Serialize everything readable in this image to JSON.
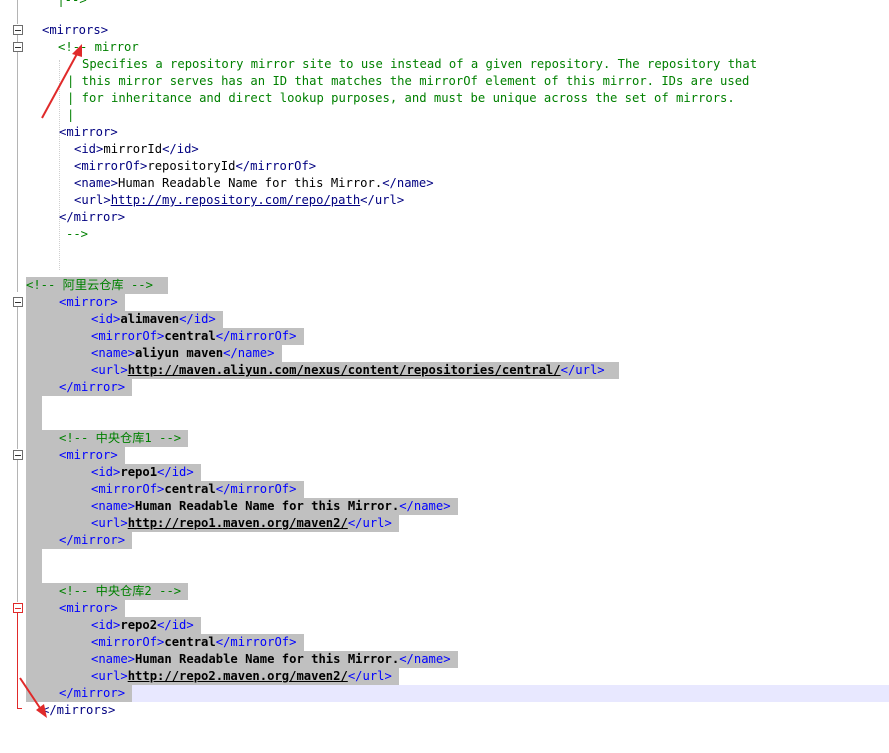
{
  "code_lines": [
    {
      "text": " |-->",
      "cls": "cm"
    },
    {
      "text": "<mirrors>",
      "cls": "tag-dark"
    },
    {
      "text": "<!-- mirror",
      "cls": "cm"
    },
    {
      "text": "Specifies a repository mirror site to use instead of a given repository. The repository that",
      "cls": "cm"
    },
    {
      "text": "| this mirror serves has an ID that matches the mirrorOf element of this mirror. IDs are used",
      "cls": "cm"
    },
    {
      "text": "| for inheritance and direct lookup purposes, and must be unique across the set of mirrors.",
      "cls": "cm"
    },
    {
      "text": "|",
      "cls": "cm"
    },
    {
      "text": "<mirror>",
      "cls": "tag-dark"
    },
    {
      "open": "<id>",
      "value": "mirrorId",
      "close": "</id>"
    },
    {
      "open": "<mirrorOf>",
      "value": "repositoryId",
      "close": "</mirrorOf>"
    },
    {
      "open": "<name>",
      "value": "Human Readable Name for this Mirror.",
      "close": "</name>"
    },
    {
      "open": "<url>",
      "link": "http://my.repository.com/repo/path",
      "close": "</url>"
    },
    {
      "text": "</mirror>",
      "cls": "tag-dark"
    },
    {
      "text": "-->",
      "cls": "cm"
    }
  ],
  "selected_lines": {
    "aliyun_comment": "<!-- 阿里云仓库 -->",
    "mirror_open": "<mirror>",
    "mirror_close": "</mirror>",
    "aliyun": {
      "id_open": "<id>",
      "id": "alimaven",
      "id_close": "</id>",
      "mirrorOf_open": "<mirrorOf>",
      "mirrorOf": "central",
      "mirrorOf_close": "</mirrorOf>",
      "name_open": "<name>",
      "name": "aliyun maven",
      "name_close": "</name>",
      "url_open": "<url>",
      "url": "http://maven.aliyun.com/nexus/content/repositories/central/",
      "url_close": "</url>"
    },
    "repo1_comment": "<!-- 中央仓库1 -->",
    "repo1": {
      "id_open": "<id>",
      "id": "repo1",
      "id_close": "</id>",
      "mirrorOf_open": "<mirrorOf>",
      "mirrorOf": "central",
      "mirrorOf_close": "</mirrorOf>",
      "name_open": "<name>",
      "name": "Human Readable Name for this Mirror.",
      "name_close": "</name>",
      "url_open": "<url>",
      "url": "http://repo1.maven.org/maven2/",
      "url_close": "</url>"
    },
    "repo2_comment": "<!-- 中央仓库2 -->",
    "repo2": {
      "id_open": "<id>",
      "id": "repo2",
      "id_close": "</id>",
      "mirrorOf_open": "<mirrorOf>",
      "mirrorOf": "central",
      "mirrorOf_close": "</mirrorOf>",
      "name_open": "<name>",
      "name": "Human Readable Name for this Mirror.",
      "name_close": "</name>",
      "url_open": "<url>",
      "url": "http://repo2.maven.org/maven2/",
      "url_close": "</url>"
    }
  },
  "mirrors_close": "</mirrors>",
  "colors": {
    "tag": "#0000ff",
    "comment": "#008000",
    "selection": "#c0c0c0",
    "current_line": "#e8e8ff",
    "annotation_arrow": "#e02a2a"
  },
  "icons": [
    "fold-minus-icon",
    "arrow-annotation-icon"
  ]
}
